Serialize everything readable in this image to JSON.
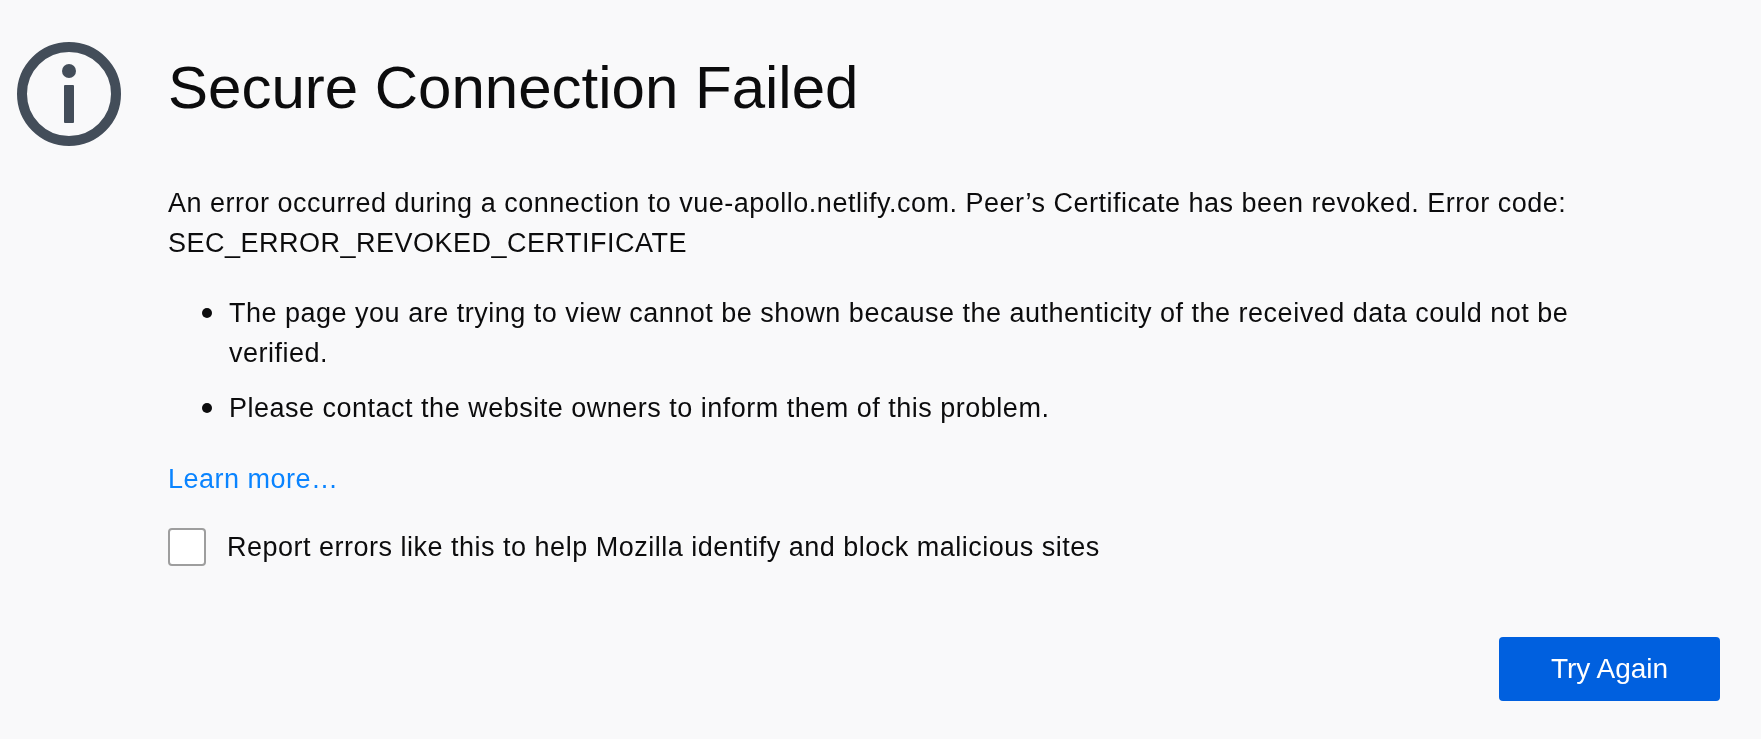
{
  "title": "Secure Connection Failed",
  "message": "An error occurred during a connection to vue-apollo.netlify.com. Peer’s Certificate has been revoked. Error code:",
  "error_code": "SEC_ERROR_REVOKED_CERTIFICATE",
  "details": [
    "The page you are trying to view cannot be shown because the authenticity of the received data could not be verified.",
    "Please contact the website owners to inform them of this problem."
  ],
  "learn_more_link": "Learn more…",
  "report_checkbox": {
    "label": "Report errors like this to help Mozilla identify and block malicious sites",
    "checked": false
  },
  "try_again_button": {
    "label": "Try Again"
  }
}
